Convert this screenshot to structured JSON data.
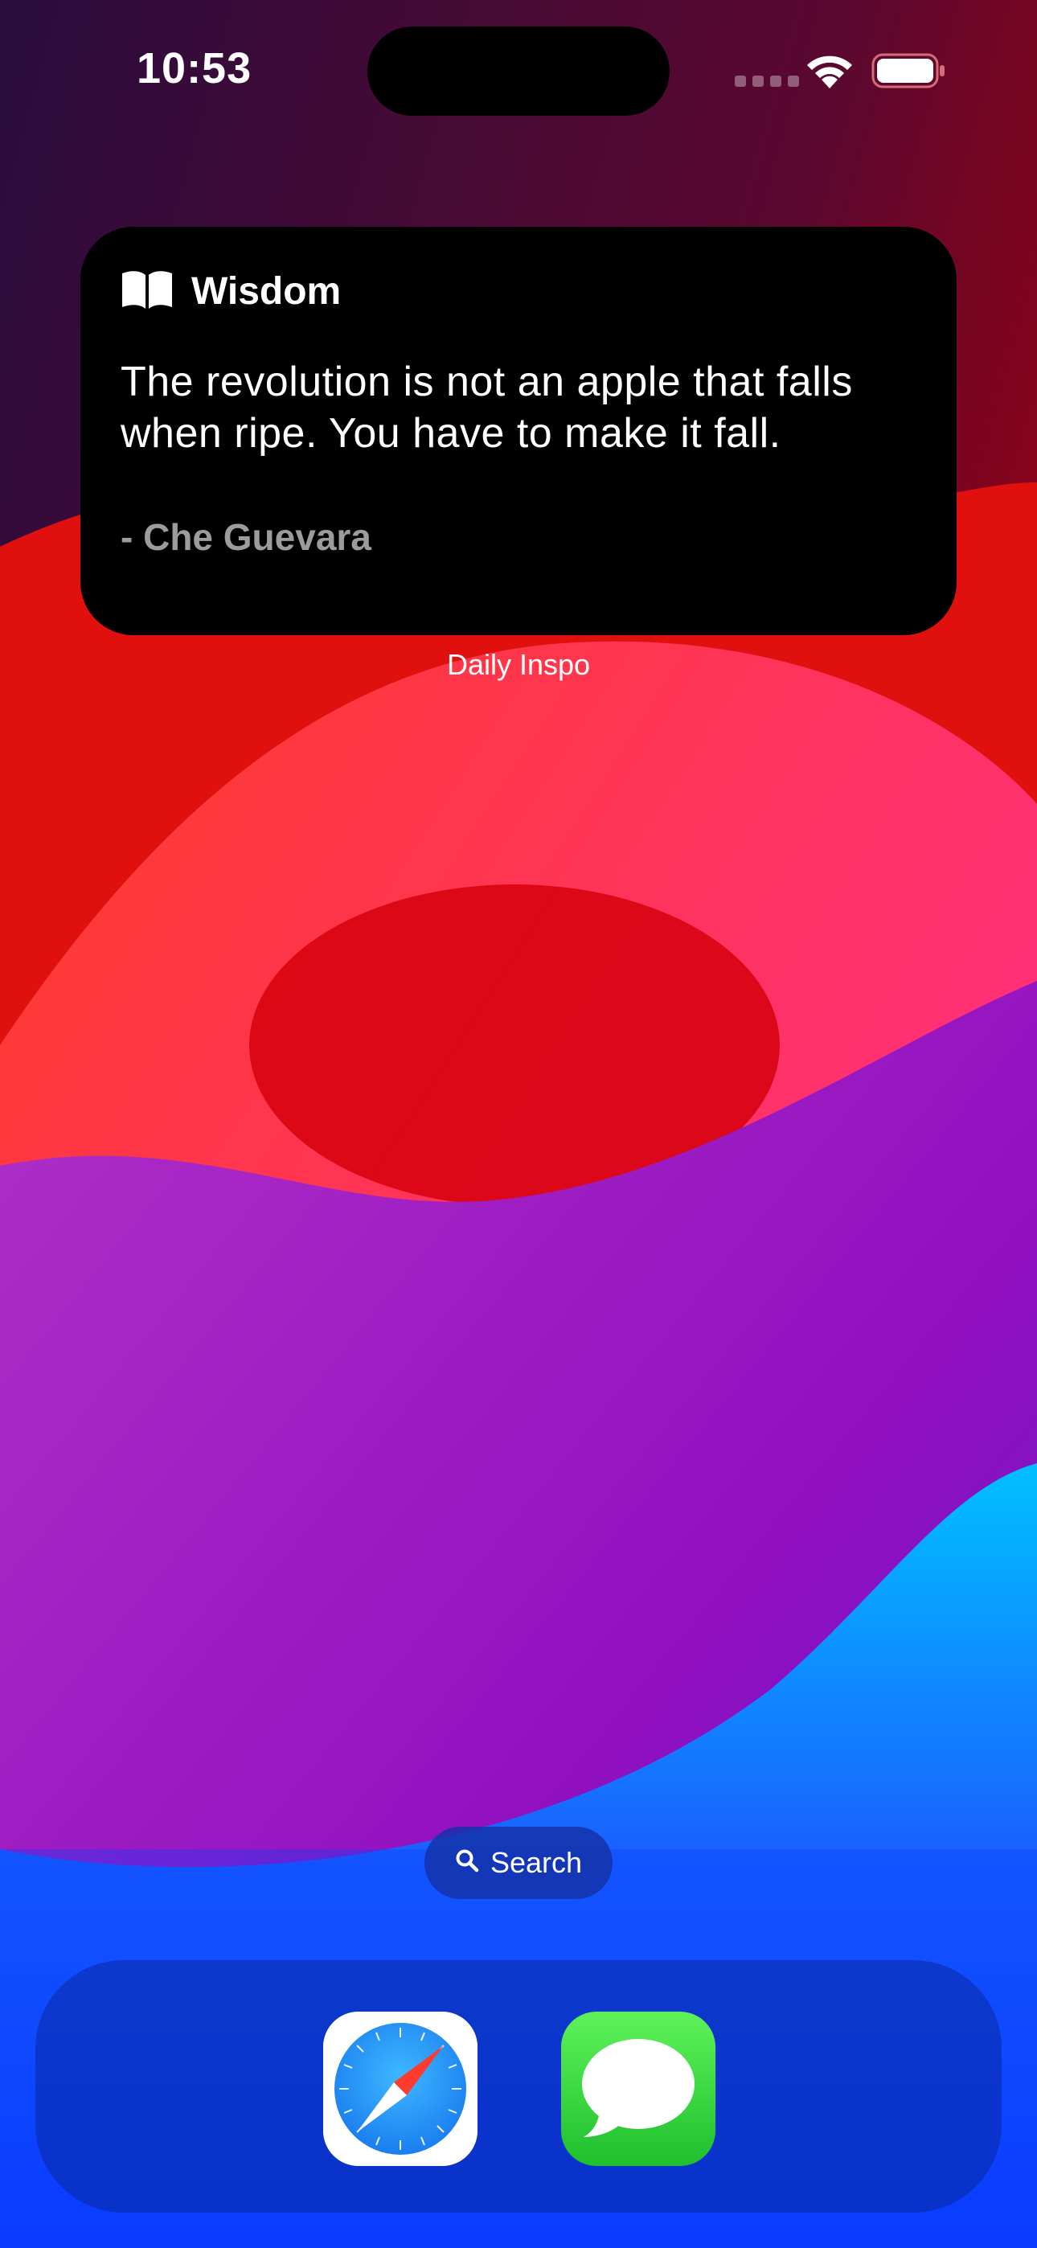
{
  "status_bar": {
    "time": "10:53"
  },
  "widget": {
    "icon": "book-icon",
    "title": "Wisdom",
    "quote": "The revolution is not an apple that falls when ripe. You have to make it fall.",
    "author": "- Che Guevara",
    "app_label": "Daily Inspo"
  },
  "search": {
    "icon": "search-icon",
    "label": "Search"
  },
  "dock": {
    "apps": [
      {
        "name": "Safari",
        "icon": "safari-compass-icon"
      },
      {
        "name": "Messages",
        "icon": "messages-bubble-icon"
      }
    ]
  },
  "colors": {
    "widget_bg": "#000000",
    "author_text": "#9c9c9c",
    "messages_green": "#2fd13a",
    "safari_blue": "#1e90ff"
  }
}
